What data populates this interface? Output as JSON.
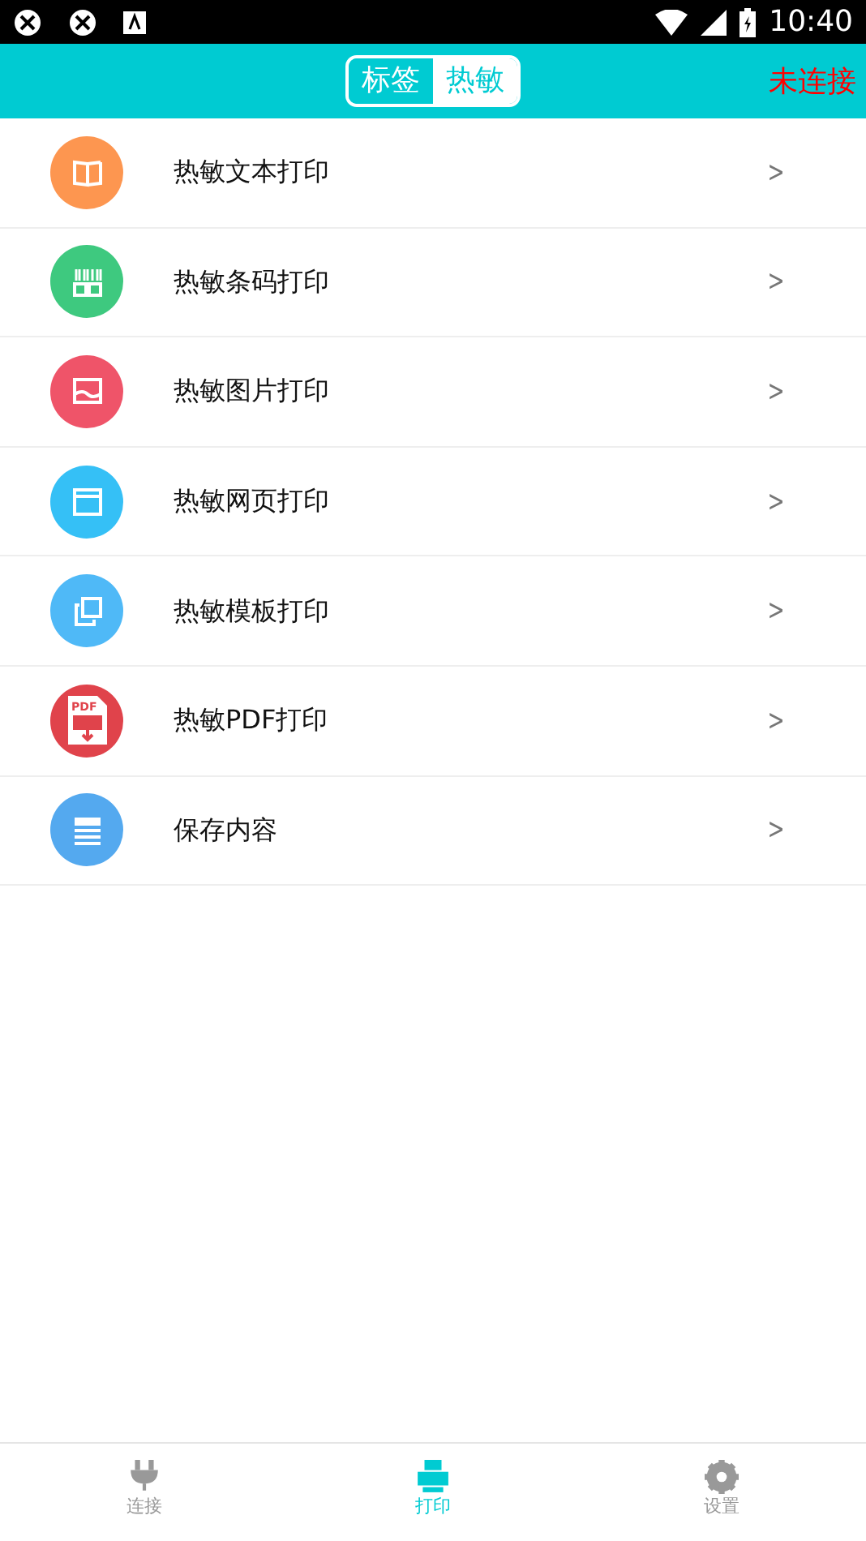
{
  "status_bar": {
    "time": "10:40"
  },
  "header": {
    "segments": [
      {
        "label": "标签",
        "selected": false
      },
      {
        "label": "热敏",
        "selected": true
      }
    ],
    "connection": "未连接"
  },
  "items": [
    {
      "kind": "book",
      "label": "热敏文本打印",
      "color": "#fd9650",
      "arrow": ">"
    },
    {
      "kind": "barcode",
      "label": "热敏条码打印",
      "color": "#3ec97f",
      "arrow": ">"
    },
    {
      "kind": "image",
      "label": "热敏图片打印",
      "color": "#ef5469",
      "arrow": ">"
    },
    {
      "kind": "web",
      "label": "热敏网页打印",
      "color": "#35c0f6",
      "arrow": ">"
    },
    {
      "kind": "copy",
      "label": "热敏模板打印",
      "color": "#4fb9f7",
      "arrow": ">"
    },
    {
      "kind": "pdf",
      "label": "热敏PDF打印",
      "color": "#e0434b",
      "arrow": ">",
      "icon_text": "PDF"
    },
    {
      "kind": "list",
      "label": "保存内容",
      "color": "#54a9ef",
      "arrow": ">"
    }
  ],
  "bottom_nav": [
    {
      "kind": "plug",
      "label": "连接",
      "selected": false
    },
    {
      "kind": "printer",
      "label": "打印",
      "selected": true
    },
    {
      "kind": "gear",
      "label": "设置",
      "selected": false
    }
  ]
}
